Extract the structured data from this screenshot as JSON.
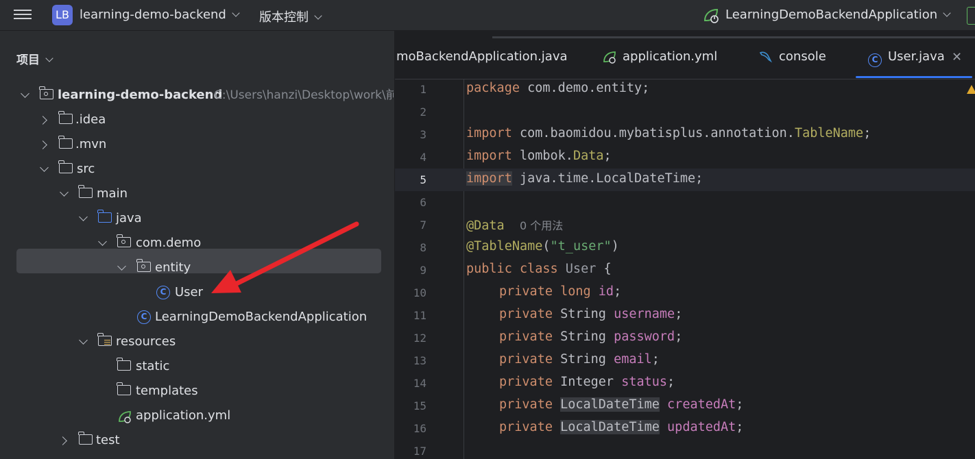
{
  "topbar": {
    "project_badge": "LB",
    "project_name": "learning-demo-backend",
    "vcs_label": "版本控制",
    "run_config": "LearningDemoBackendApplication",
    "accent_color": "#5c6ed8"
  },
  "sidebar": {
    "title": "项目",
    "tree": [
      {
        "label": "learning-demo-backend",
        "path": "C:\\Users\\hanzi\\Desktop\\work\\前"
      },
      {
        "label": ".idea"
      },
      {
        "label": ".mvn"
      },
      {
        "label": "src"
      },
      {
        "label": "main"
      },
      {
        "label": "java"
      },
      {
        "label": "com.demo"
      },
      {
        "label": "entity"
      },
      {
        "label": "User"
      },
      {
        "label": "LearningDemoBackendApplication"
      },
      {
        "label": "resources"
      },
      {
        "label": "static"
      },
      {
        "label": "templates"
      },
      {
        "label": "application.yml"
      },
      {
        "label": "test"
      }
    ]
  },
  "tabs": [
    {
      "label": "moBackendApplication.java"
    },
    {
      "label": "application.yml"
    },
    {
      "label": "console"
    },
    {
      "label": "User.java",
      "active": true
    }
  ],
  "editor": {
    "line_numbers": [
      "1",
      "2",
      "3",
      "4",
      "5",
      "6",
      "7",
      "8",
      "9",
      "10",
      "11",
      "12",
      "13",
      "14",
      "15",
      "16",
      "17"
    ],
    "current_line": 5,
    "tokens": {
      "package": "package",
      "package_name": " com.demo.entity;",
      "import": "import",
      "imp1_pre": " com.baomidou.mybatisplus.annotation.",
      "imp1_cls": "TableName",
      "semi": ";",
      "imp2_pre": " lombok.",
      "imp2_cls": "Data",
      "imp3": " java.time.LocalDateTime;",
      "at_data": "@Data",
      "usages": "0 个用法",
      "at_table": "@TableName",
      "paren_open": "(",
      "table_str": "\"t_user\"",
      "paren_close": ")",
      "public": "public",
      "class": " class ",
      "class_name": "User",
      "brace": " {",
      "private": "private",
      "t_long": " long ",
      "t_string": " String ",
      "t_integer": " Integer ",
      "t_ldt": "LocalDateTime",
      "f_id": "id",
      "f_username": "username",
      "f_password": "password",
      "f_email": "email",
      "f_status": "status",
      "f_created": "createdAt",
      "f_updated": "updatedAt"
    }
  }
}
